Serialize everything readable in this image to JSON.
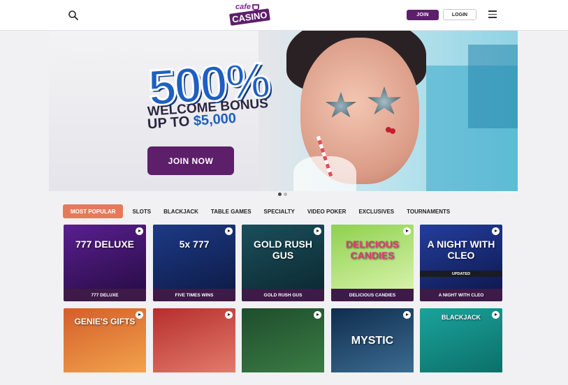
{
  "header": {
    "logo_top": "cafe",
    "logo_bottom": "CASINO",
    "join_label": "JOIN",
    "login_label": "LOGIN",
    "icons": [
      "search-icon",
      "menu-icon"
    ]
  },
  "hero": {
    "percent": "500%",
    "line1": "WELCOME BONUS",
    "line2_prefix": "UP TO ",
    "line2_amount": "$5,000",
    "cta_label": "JOIN NOW",
    "slide_count": 2,
    "active_slide": 1
  },
  "tabs": [
    "MOST POPULAR",
    "SLOTS",
    "BLACKJACK",
    "TABLE GAMES",
    "SPECIALTY",
    "VIDEO POKER",
    "EXCLUSIVES",
    "TOURNAMENTS"
  ],
  "games_row1": [
    {
      "art_text": "777 DELUXE",
      "caption": "777 DELUXE",
      "bg": [
        "#5a1f8f",
        "#2a0d4a"
      ]
    },
    {
      "art_text": "5x 777",
      "caption": "FIVE TIMES WINS",
      "bg": [
        "#1d3a86",
        "#0e1d4a"
      ]
    },
    {
      "art_text": "GOLD RUSH GUS",
      "caption": "GOLD RUSH GUS",
      "bg": [
        "#1a4f5c",
        "#0d2b33"
      ]
    },
    {
      "art_text": "DELICIOUS CANDIES",
      "caption": "DELICIOUS CANDIES",
      "bg": [
        "#8ed14f",
        "#d6f2a8"
      ]
    },
    {
      "art_text": "A NIGHT WITH CLEO",
      "caption": "A NIGHT WITH CLEO",
      "badge": "UPDATED",
      "bg": [
        "#233e9c",
        "#0f1a52"
      ]
    }
  ],
  "games_row2": [
    {
      "art_text": "GENIE'S GIFTS",
      "bg": [
        "#d45e2a",
        "#f2a34c"
      ]
    },
    {
      "art_text": "",
      "bg": [
        "#b52e2e",
        "#e37b6a"
      ]
    },
    {
      "art_text": "",
      "bg": [
        "#1f4d2c",
        "#3a7c44"
      ]
    },
    {
      "art_text": "MYSTIC",
      "bg": [
        "#0f2d4d",
        "#3c6c92"
      ]
    },
    {
      "art_text": "BLACKJACK",
      "bg": [
        "#1aa39b",
        "#0c6f69"
      ]
    }
  ]
}
